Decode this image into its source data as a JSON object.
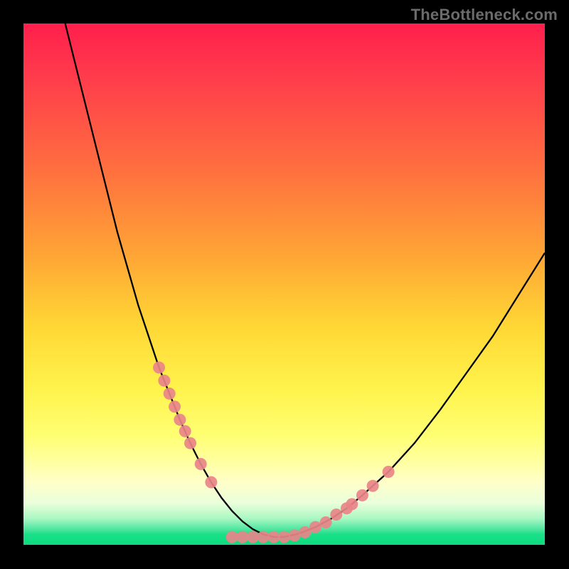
{
  "watermark": "TheBottleneck.com",
  "chart_data": {
    "type": "line",
    "title": "",
    "xlabel": "",
    "ylabel": "",
    "xlim": [
      0,
      100
    ],
    "ylim": [
      0,
      100
    ],
    "series": [
      {
        "name": "bottleneck-curve",
        "x": [
          8,
          10,
          12,
          14,
          16,
          18,
          20,
          22,
          24,
          26,
          28,
          30,
          32,
          34,
          36,
          38,
          40,
          42,
          44,
          46,
          48,
          50,
          53,
          56,
          59,
          62,
          65,
          70,
          75,
          80,
          85,
          90,
          95,
          100
        ],
        "values": [
          100,
          92,
          84,
          76,
          68,
          60,
          53,
          46,
          40,
          34,
          29,
          24,
          19.5,
          15.5,
          12,
          9,
          6.5,
          4.5,
          3,
          2,
          1.5,
          1.5,
          2.2,
          3.4,
          5,
          7,
          9.5,
          14,
          19.5,
          26,
          33,
          40,
          48,
          56
        ]
      }
    ],
    "markers": {
      "left": {
        "x": [
          26,
          27,
          28,
          29,
          30,
          31,
          32,
          34,
          36
        ],
        "y": [
          34,
          31.5,
          29,
          26.5,
          24,
          21.8,
          19.5,
          15.5,
          12
        ]
      },
      "right": {
        "x": [
          56,
          58,
          60,
          62,
          63,
          65,
          67,
          70
        ],
        "y": [
          3.4,
          4.3,
          5.8,
          7,
          7.8,
          9.5,
          11.3,
          14
        ]
      },
      "floor": {
        "x": [
          40,
          42,
          44,
          46,
          48,
          50,
          52,
          54
        ],
        "y": [
          1.5,
          1.5,
          1.5,
          1.5,
          1.5,
          1.5,
          1.8,
          2.4
        ]
      }
    },
    "marker_color": "#e98489",
    "curve_color": "#000000"
  }
}
